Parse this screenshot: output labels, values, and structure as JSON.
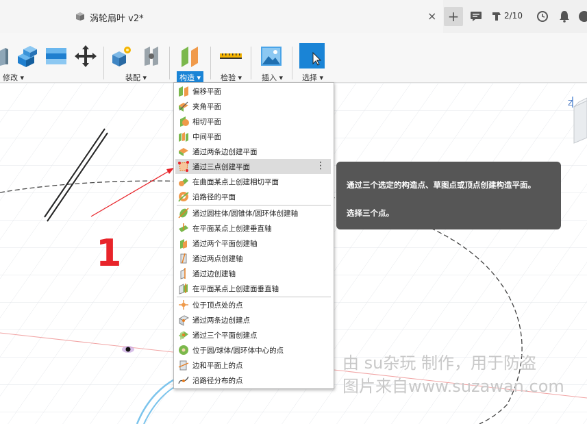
{
  "document": {
    "title": "涡轮扇叶 v2*",
    "close_symbol": "×"
  },
  "topbar": {
    "new_tab_symbol": "+",
    "job_status": "2/10",
    "icons": [
      "plus-icon",
      "comment-icon",
      "job-status-icon",
      "clock-icon",
      "bell-icon",
      "help-icon"
    ]
  },
  "toolbar": {
    "groups": [
      {
        "label": "修改 ▾"
      },
      {
        "label": "装配 ▾"
      },
      {
        "label": "构造 ▾"
      },
      {
        "label": "检验 ▾"
      },
      {
        "label": "插入 ▾"
      },
      {
        "label": "选择 ▾"
      }
    ],
    "accent": "#1a84d6"
  },
  "menu": {
    "items": [
      {
        "label": "偏移平面",
        "icon": "offset-plane-icon"
      },
      {
        "label": "夹角平面",
        "icon": "plane-at-angle-icon"
      },
      {
        "label": "相切平面",
        "icon": "tangent-plane-icon"
      },
      {
        "label": "中间平面",
        "icon": "midplane-icon"
      },
      {
        "label": "通过两条边创建平面",
        "icon": "plane-through-two-edges-icon"
      },
      {
        "label": "通过三点创建平面",
        "icon": "plane-through-three-points-icon"
      },
      {
        "label": "在曲面某点上创建相切平面",
        "icon": "plane-tangent-at-point-icon"
      },
      {
        "label": "沿路径的平面",
        "icon": "plane-along-path-icon"
      },
      {
        "label": "通过圆柱体/圆锥体/圆环体创建轴",
        "icon": "axis-through-cylinder-icon"
      },
      {
        "label": "在平面某点上创建垂直轴",
        "icon": "axis-perpendicular-at-point-icon"
      },
      {
        "label": "通过两个平面创建轴",
        "icon": "axis-through-two-planes-icon"
      },
      {
        "label": "通过两点创建轴",
        "icon": "axis-through-two-points-icon"
      },
      {
        "label": "通过边创建轴",
        "icon": "axis-through-edge-icon"
      },
      {
        "label": "在平面某点上创建面垂直轴",
        "icon": "axis-perpendicular-to-face-icon"
      },
      {
        "label": "位于顶点处的点",
        "icon": "point-at-vertex-icon"
      },
      {
        "label": "通过两条边创建点",
        "icon": "point-through-two-edges-icon"
      },
      {
        "label": "通过三个平面创建点",
        "icon": "point-through-three-planes-icon"
      },
      {
        "label": "位于圆/球体/圆环体中心的点",
        "icon": "point-at-center-icon"
      },
      {
        "label": "边和平面上的点",
        "icon": "point-at-edge-and-plane-icon"
      },
      {
        "label": "沿路径分布的点",
        "icon": "point-along-path-icon"
      }
    ],
    "highlighted_index": 5,
    "more_symbol": "⋮"
  },
  "tooltip": {
    "description": "通过三个选定的构造点、草图点或顶点创建构造平面。",
    "hint": "选择三个点。"
  },
  "annotation": {
    "step_number": "1",
    "color": "#e8242a"
  },
  "viewcube": {
    "axis_label": "Z"
  },
  "watermark": {
    "line1": "由 su杂玩 制作，用于防盗",
    "line2": "图片来自www.suzawan.com"
  }
}
